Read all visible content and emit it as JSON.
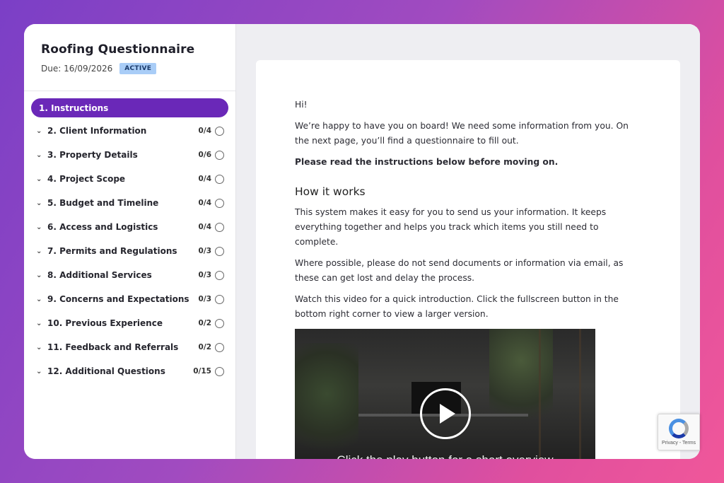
{
  "sidebar": {
    "title": "Roofing Questionnaire",
    "due": "Due: 16/09/2026",
    "status": "ACTIVE",
    "active_item": "1. Instructions",
    "items": [
      {
        "label": "2. Client Information",
        "count": "0/4"
      },
      {
        "label": "3. Property Details",
        "count": "0/6"
      },
      {
        "label": "4. Project Scope",
        "count": "0/4"
      },
      {
        "label": "5. Budget and Timeline",
        "count": "0/4"
      },
      {
        "label": "6. Access and Logistics",
        "count": "0/4"
      },
      {
        "label": "7. Permits and Regulations",
        "count": "0/3"
      },
      {
        "label": "8. Additional Services",
        "count": "0/3"
      },
      {
        "label": "9. Concerns and Expectations",
        "count": "0/3"
      },
      {
        "label": "10. Previous Experience",
        "count": "0/2"
      },
      {
        "label": "11. Feedback and Referrals",
        "count": "0/2"
      },
      {
        "label": "12. Additional Questions",
        "count": "0/15"
      }
    ]
  },
  "content": {
    "greeting": "Hi!",
    "intro": "We’re happy to have you on board! We need some information from you. On the next page, you’ll find a questionnaire to fill out.",
    "instruction": "Please read the instructions below before moving on.",
    "heading": "How it works",
    "para1": "This system makes it easy for you to send us your information. It keeps everything together and helps you track which items you still need to complete.",
    "para2": "Where possible, please do not send documents or information via email, as these can get lost and delay the process.",
    "para3": "Watch this video for a quick introduction. Click the fullscreen button in the bottom right corner to view a larger version.",
    "video_caption": "Click the play button for a short overview"
  },
  "recaptcha": {
    "text": "Privacy - Terms"
  }
}
